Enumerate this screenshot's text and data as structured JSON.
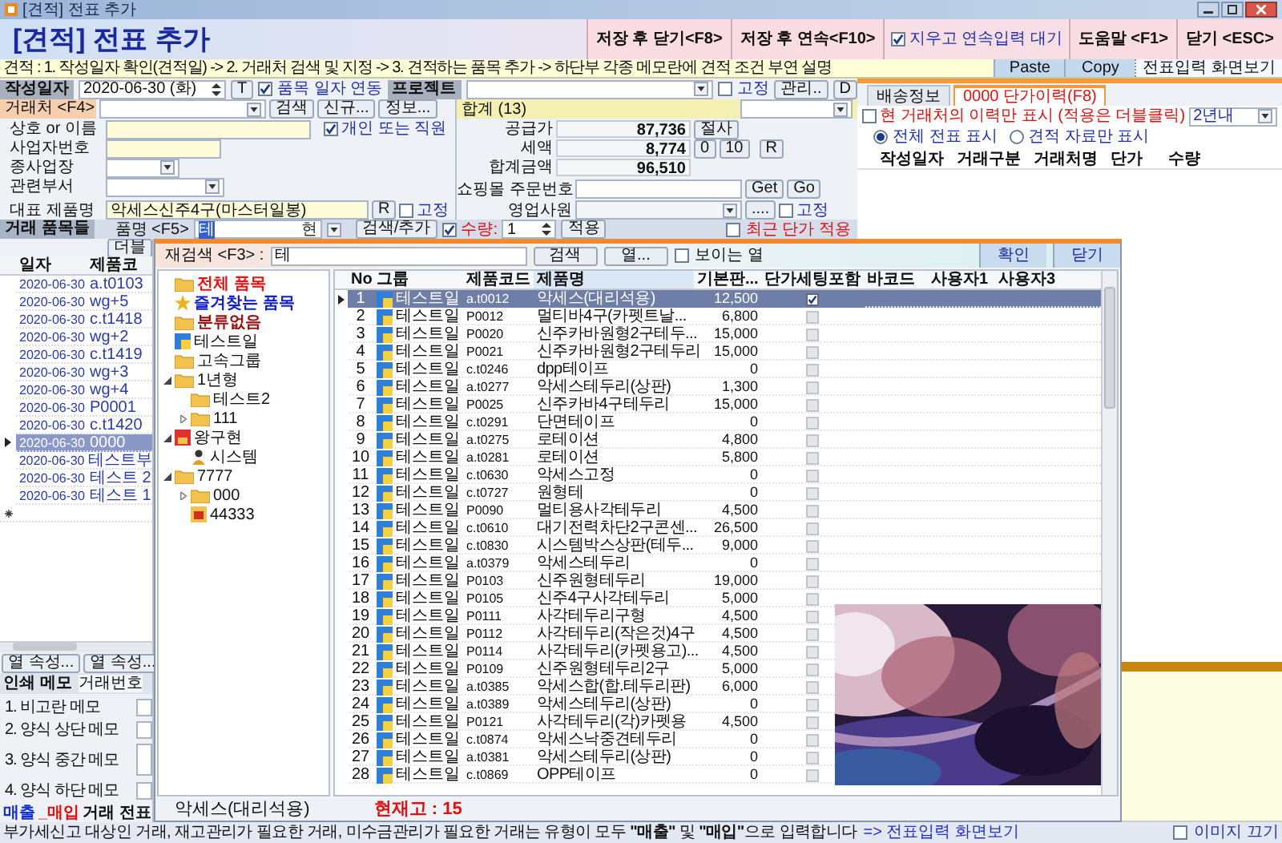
{
  "window": {
    "title": "[견적] 전표 추가"
  },
  "header": {
    "title": "[견적] 전표 추가",
    "buttons": [
      {
        "label": "저장 후 닫기<F8>",
        "kind": "button"
      },
      {
        "label": "저장 후 연속<F10>",
        "kind": "button"
      },
      {
        "label": "지우고 연속입력 대기",
        "kind": "checkbox",
        "checked": true
      },
      {
        "label": "도움말 <F1>",
        "kind": "button"
      },
      {
        "label": "닫기 <ESC>",
        "kind": "button"
      }
    ]
  },
  "instruction": "견적 : 1. 작성일자 확인(견적일) -> 2. 거래처 검색 및 지정 -> 3. 견적하는 품목 추가 -> 하단부 각종 메모란에 견적 조건 부연 설명",
  "clipboard_buttons": [
    "Paste",
    "Copy"
  ],
  "view_button": "전표입력 화면보기",
  "date_row": {
    "label": "작성일자",
    "date": "2020-06-30 (화)",
    "t_button": "T",
    "link_dates": {
      "label": "품목 일자 연동",
      "checked": true
    },
    "project_label": "프로젝트",
    "fixed": {
      "label": "고정",
      "checked": false
    },
    "manage_button": "관리..",
    "d_button": "D"
  },
  "customer": {
    "label": "거래처 <F4>",
    "buttons": [
      "검색",
      "신규...",
      "정보..."
    ],
    "name_label": "상호 or 이름",
    "personal": {
      "label": "개인 또는 직원",
      "checked": true
    },
    "biz_no_label": "사업자번호",
    "branch_label": "종사업장",
    "dept_label": "관련부서",
    "product_label": "대표 제품명",
    "product": "악세스신주4구(마스터일봉)",
    "r_button": "R",
    "fixed": {
      "label": "고정",
      "checked": false
    }
  },
  "totals": {
    "title": "합계 (13)",
    "supply_label": "공급가",
    "supply": "87,736",
    "cut_button": "절사",
    "tax_label": "세액",
    "tax": "8,774",
    "tax_buttons": [
      "0",
      "10"
    ],
    "r_button": "R",
    "total_label": "합계금액",
    "total": "96,510",
    "order_label": "쇼핑몰 주문번호",
    "order_buttons": [
      "Get",
      "Go"
    ],
    "sales_label": "영업사원",
    "more_button": "....",
    "fixed": {
      "label": "고정",
      "checked": false
    }
  },
  "history": {
    "tabs": [
      {
        "label": "배송정보",
        "selected": false
      },
      {
        "label": "0000 단가이력(F8)",
        "selected": true
      }
    ],
    "only_customer": {
      "label": "현 거래처의 이력만 표시 (적용은 더블클릭)",
      "checked": false
    },
    "period": "2년내",
    "radios": [
      {
        "label": "전체 전표 표시",
        "selected": true
      },
      {
        "label": "견적 자료만 표시",
        "selected": false
      }
    ],
    "columns": [
      "작성일자",
      "거래구분",
      "거래처명",
      "단가",
      "수량"
    ],
    "image_toggle": {
      "label": "이미지 끄기",
      "checked": false
    }
  },
  "items_bar": {
    "title": "거래 품목들",
    "item_label": "품명 <F5>",
    "item_value": "테",
    "ime": "현",
    "search_button": "검색/추가",
    "qty": {
      "label": "수량:",
      "checked": true
    },
    "qty_value": "1",
    "apply_button": "적용",
    "recent_price": {
      "label": "최근 단가 적용",
      "checked": false
    }
  },
  "item_list": {
    "button": "더블",
    "columns": [
      "일자",
      "제품코"
    ],
    "rows": [
      {
        "date": "2020-06-30",
        "code": "a.t0103",
        "selected": false
      },
      {
        "date": "2020-06-30",
        "code": "wg+5",
        "selected": false
      },
      {
        "date": "2020-06-30",
        "code": "c.t1418",
        "selected": false
      },
      {
        "date": "2020-06-30",
        "code": "wg+2",
        "selected": false
      },
      {
        "date": "2020-06-30",
        "code": "c.t1419",
        "selected": false
      },
      {
        "date": "2020-06-30",
        "code": "wg+3",
        "selected": false
      },
      {
        "date": "2020-06-30",
        "code": "wg+4",
        "selected": false
      },
      {
        "date": "2020-06-30",
        "code": "P0001",
        "selected": false
      },
      {
        "date": "2020-06-30",
        "code": "c.t1420",
        "selected": false
      },
      {
        "date": "2020-06-30",
        "code": "0000",
        "selected": true
      },
      {
        "date": "2020-06-30",
        "code": "테스트부",
        "selected": false
      },
      {
        "date": "2020-06-30",
        "code": "테스트 2",
        "selected": false
      },
      {
        "date": "2020-06-30",
        "code": "테스트 1",
        "selected": false
      }
    ],
    "buttons": [
      "열 속성...",
      "열 속성..."
    ]
  },
  "memo": {
    "title": "인쇄 메모",
    "number_label": "거래번호",
    "fields": [
      {
        "label": "1. 비고란 메모",
        "kind": "line"
      },
      {
        "label": "2. 양식 상단 메모",
        "kind": "line"
      },
      {
        "label": "3. 양식 중간 메모",
        "kind": "area"
      },
      {
        "label": "4. 양식 하단 메모",
        "kind": "line"
      }
    ]
  },
  "trade_type": [
    {
      "label": "매출",
      "color": "#1030d0"
    },
    {
      "label": "_매입",
      "color": "#e01010"
    },
    {
      "label": "거래 전표",
      "color": "#101010"
    }
  ],
  "status_bar": {
    "text": "부가세신고 대상인 거래, 재고관리가 필요한 거래, 미수금관리가 필요한 거래는 유형이 모두 **\"매출\"** 및 **\"매입\"**으로 입력합니다",
    "link": "=> 전표입력 화면보기"
  },
  "search_popup": {
    "search_label": "재검색 <F3> :",
    "search_value": "테",
    "buttons": [
      "검색",
      "열..."
    ],
    "visible_cols": {
      "label": "보이는 열",
      "checked": false
    },
    "confirm": "확인",
    "close": "닫기",
    "tree": [
      {
        "label": "전체 품목",
        "kind": "folder",
        "color": "#ee1111"
      },
      {
        "label": "즐겨찾는 품목",
        "kind": "star",
        "color": "#1020cc"
      },
      {
        "label": "분류없음",
        "kind": "folder",
        "color": "#991111"
      },
      {
        "label": "테스트일",
        "kind": "tag"
      },
      {
        "label": "고속그룹",
        "kind": "folder"
      },
      {
        "label": "1년형",
        "kind": "folder",
        "expanded": true,
        "children": [
          {
            "label": "테스트2",
            "kind": "folder"
          },
          {
            "label": "111",
            "kind": "folder",
            "expanded": false
          }
        ]
      },
      {
        "label": "왕구현",
        "kind": "box",
        "expanded": true,
        "children": [
          {
            "label": "시스템",
            "kind": "user"
          }
        ]
      },
      {
        "label": "7777",
        "kind": "folder",
        "expanded": true,
        "children": [
          {
            "label": "000",
            "kind": "folder",
            "expanded": false
          },
          {
            "label": "44333",
            "kind": "note"
          }
        ]
      }
    ],
    "columns": [
      "No",
      "그룹",
      "제품코드",
      "제품명",
      "기본판...",
      "단가세팅포함",
      "바코드",
      "사용자1",
      "사용자3"
    ],
    "rows": [
      {
        "no": "1",
        "group": "테스트일",
        "code": "a.t0012",
        "name": "악세스(대리석용)",
        "price": "12,500",
        "checked": true,
        "selected": true
      },
      {
        "no": "2",
        "group": "테스트일",
        "code": "P0012",
        "name": "멀티바4구(카펫트날...",
        "price": "6,800",
        "checked": false,
        "selected": false
      },
      {
        "no": "3",
        "group": "테스트일",
        "code": "P0020",
        "name": "신주카바원형2구테두...",
        "price": "15,000",
        "checked": false,
        "selected": false
      },
      {
        "no": "4",
        "group": "테스트일",
        "code": "P0021",
        "name": "신주카바원형2구테두리",
        "price": "15,000",
        "checked": false,
        "selected": false
      },
      {
        "no": "5",
        "group": "테스트일",
        "code": "c.t0246",
        "name": "dpp테이프",
        "price": "0",
        "checked": false,
        "selected": false
      },
      {
        "no": "6",
        "group": "테스트일",
        "code": "a.t0277",
        "name": "악세스테두리(상판)",
        "price": "1,300",
        "checked": false,
        "selected": false
      },
      {
        "no": "7",
        "group": "테스트일",
        "code": "P0025",
        "name": "신주카바4구테두리",
        "price": "15,000",
        "checked": false,
        "selected": false
      },
      {
        "no": "8",
        "group": "테스트일",
        "code": "c.t0291",
        "name": "단면테이프",
        "price": "0",
        "checked": false,
        "selected": false
      },
      {
        "no": "9",
        "group": "테스트일",
        "code": "a.t0275",
        "name": "로테이션",
        "price": "4,800",
        "checked": false,
        "selected": false
      },
      {
        "no": "10",
        "group": "테스트일",
        "code": "a.t0281",
        "name": "로테이션",
        "price": "5,800",
        "checked": false,
        "selected": false
      },
      {
        "no": "11",
        "group": "테스트일",
        "code": "c.t0630",
        "name": "악세스고정",
        "price": "0",
        "checked": false,
        "selected": false
      },
      {
        "no": "12",
        "group": "테스트일",
        "code": "c.t0727",
        "name": "원형테",
        "price": "0",
        "checked": false,
        "selected": false
      },
      {
        "no": "13",
        "group": "테스트일",
        "code": "P0090",
        "name": "멀티용사각테두리",
        "price": "4,500",
        "checked": false,
        "selected": false
      },
      {
        "no": "14",
        "group": "테스트일",
        "code": "c.t0610",
        "name": "대기전력차단2구콘센...",
        "price": "26,500",
        "checked": false,
        "selected": false
      },
      {
        "no": "15",
        "group": "테스트일",
        "code": "c.t0830",
        "name": "시스템박스상판(테두...",
        "price": "9,000",
        "checked": false,
        "selected": false
      },
      {
        "no": "16",
        "group": "테스트일",
        "code": "a.t0379",
        "name": "악세스테두리",
        "price": "0",
        "checked": false,
        "selected": false
      },
      {
        "no": "17",
        "group": "테스트일",
        "code": "P0103",
        "name": "신주원형테두리",
        "price": "19,000",
        "checked": false,
        "selected": false
      },
      {
        "no": "18",
        "group": "테스트일",
        "code": "P0105",
        "name": "신주4구사각테두리",
        "price": "5,000",
        "checked": false,
        "selected": false
      },
      {
        "no": "19",
        "group": "테스트일",
        "code": "P0111",
        "name": "사각테두리구형",
        "price": "4,500",
        "checked": false,
        "selected": false
      },
      {
        "no": "20",
        "group": "테스트일",
        "code": "P0112",
        "name": "사각테두리(작은것)4구",
        "price": "4,500",
        "checked": false,
        "selected": false
      },
      {
        "no": "21",
        "group": "테스트일",
        "code": "P0114",
        "name": "사각테두리(카펫용고)...",
        "price": "4,500",
        "checked": false,
        "selected": false
      },
      {
        "no": "22",
        "group": "테스트일",
        "code": "P0109",
        "name": "신주원형테두리2구",
        "price": "5,000",
        "checked": false,
        "selected": false
      },
      {
        "no": "23",
        "group": "테스트일",
        "code": "a.t0385",
        "name": "악세스합(합.테두리판)",
        "price": "6,000",
        "checked": false,
        "selected": false
      },
      {
        "no": "24",
        "group": "테스트일",
        "code": "a.t0389",
        "name": "악세스테두리(상판)",
        "price": "0",
        "checked": false,
        "selected": false
      },
      {
        "no": "25",
        "group": "테스트일",
        "code": "P0121",
        "name": "사각테두리(각)카펫용",
        "price": "4,500",
        "checked": false,
        "selected": false
      },
      {
        "no": "26",
        "group": "테스트일",
        "code": "c.t0874",
        "name": "악세스낙중견테두리",
        "price": "0",
        "checked": false,
        "selected": false
      },
      {
        "no": "27",
        "group": "테스트일",
        "code": "a.t0381",
        "name": "악세스테두리(상판)",
        "price": "0",
        "checked": false,
        "selected": false
      },
      {
        "no": "28",
        "group": "테스트일",
        "code": "c.t0869",
        "name": "OPP테이프",
        "price": "0",
        "checked": false,
        "selected": false
      }
    ],
    "image": {
      "kind": "picture"
    },
    "footer_name": "악세스(대리석용)",
    "footer_stock": "현재고 : 15"
  }
}
